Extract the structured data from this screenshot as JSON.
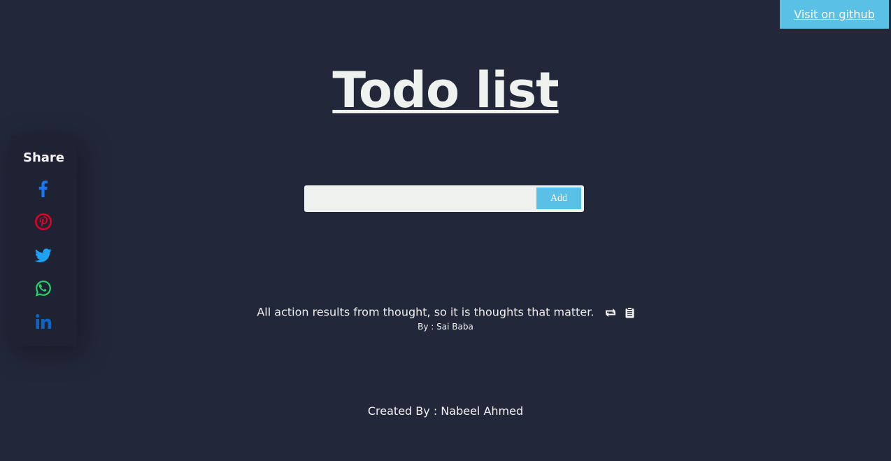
{
  "github": {
    "label": "Visit on github"
  },
  "header": {
    "title": "Todo list"
  },
  "share": {
    "title": "Share",
    "items": [
      {
        "name": "facebook-icon",
        "color": "#1877f2"
      },
      {
        "name": "pinterest-icon",
        "color": "#e60023"
      },
      {
        "name": "twitter-icon",
        "color": "#1da1f2"
      },
      {
        "name": "whatsapp-icon",
        "color": "#25d366"
      },
      {
        "name": "linkedin-icon",
        "color": "#0a66c2"
      }
    ]
  },
  "todo": {
    "input_value": "",
    "placeholder": "",
    "add_label": "Add"
  },
  "quote": {
    "text": "All action results from thought, so it is thoughts that matter.",
    "author": "By : Sai Baba",
    "icons": [
      "refresh-icon",
      "clipboard-icon"
    ]
  },
  "footer": {
    "text": "Created By : Nabeel Ahmed"
  },
  "colors": {
    "background": "#22273a",
    "panel": "#1e2233",
    "accent": "#5bc0e5",
    "text": "#eef1ee"
  }
}
